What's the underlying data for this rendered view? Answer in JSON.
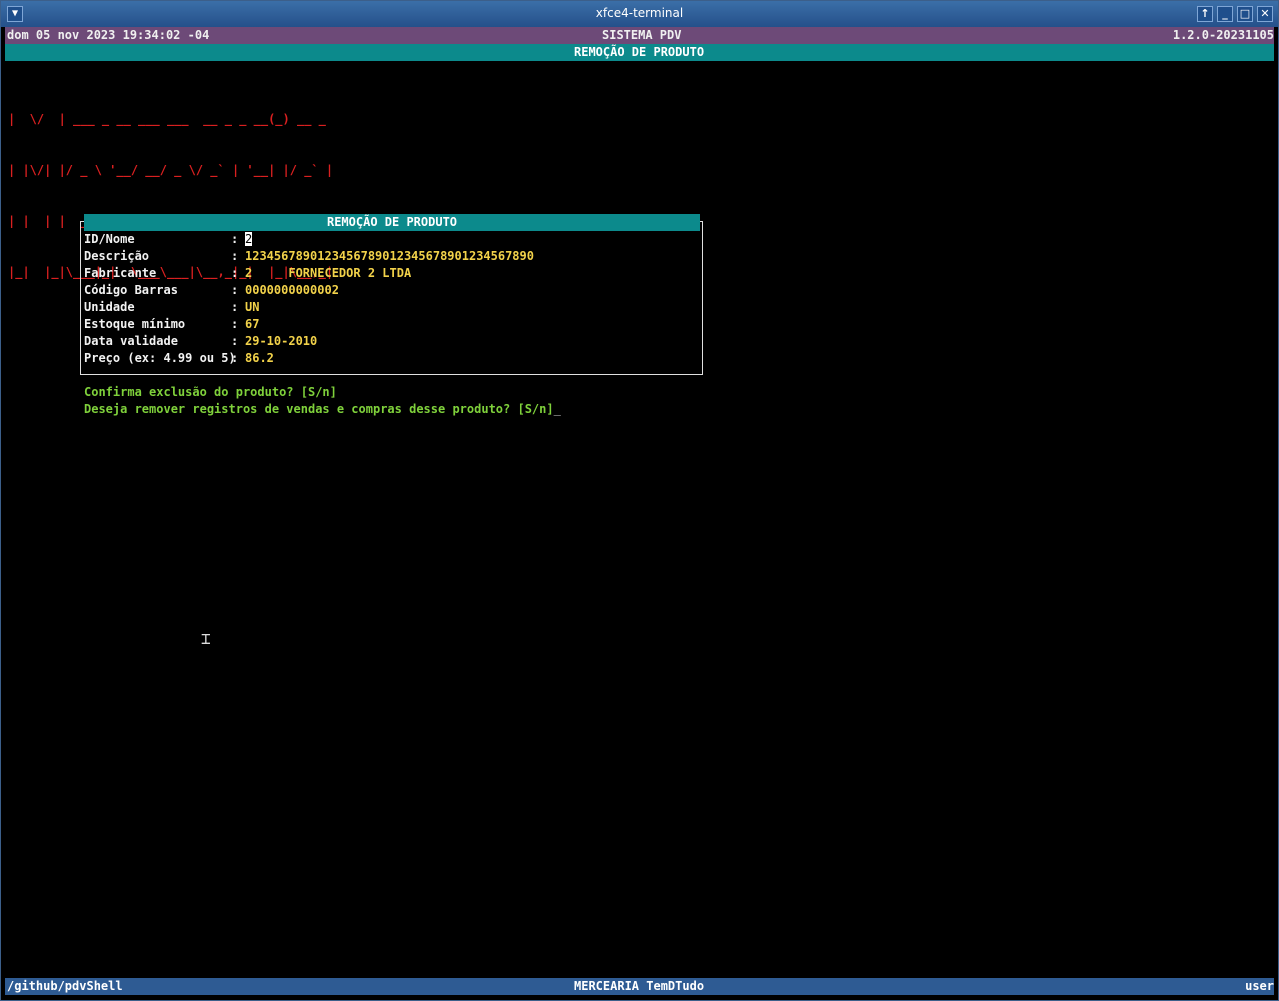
{
  "window": {
    "title": "xfce4-terminal"
  },
  "status_top": {
    "datetime": "dom 05 nov 2023 19:34:02 -04",
    "system": "SISTEMA PDV",
    "version": "1.2.0-20231105"
  },
  "subheader": "REMOÇÃO DE PRODUTO",
  "ascii_logo": [
    "|  \\/  | ___ _ __ ___ ___  __ _ _ __(_) __ _",
    "| |\\/| |/ _ \\ '__/ __/ _ \\/ _` | '__| |/ _` |",
    "| |  | |  __/ | | (_|  __/ (_| | |  | | (_| |",
    "|_|  |_|\\___|_|  \\___\\___|\\__,_|_|  |_|\\__,_|"
  ],
  "panel": {
    "title": "REMOÇÃO DE PRODUTO",
    "fields": [
      {
        "label": "ID/Nome",
        "value": "2"
      },
      {
        "label": "Descrição",
        "value": "1234567890123456789012345678901234567890"
      },
      {
        "label": "Fabricante",
        "value": "2     FORNECEDOR 2 LTDA"
      },
      {
        "label": "Código Barras",
        "value": "0000000000002"
      },
      {
        "label": "Unidade",
        "value": "UN"
      },
      {
        "label": "Estoque mínimo",
        "value": "67"
      },
      {
        "label": "Data validade",
        "value": "29-10-2010"
      },
      {
        "label": "Preço (ex: 4.99 ou 5)",
        "value": "86.2"
      }
    ]
  },
  "prompts": {
    "confirm": "Confirma exclusão do produto? [S/n]",
    "remove_records": "Deseja remover registros de vendas e compras desse produto? [S/n]"
  },
  "status_bottom": {
    "path": "/github/pdvShell",
    "store": "MERCEARIA TemDTudo",
    "user": "user"
  }
}
